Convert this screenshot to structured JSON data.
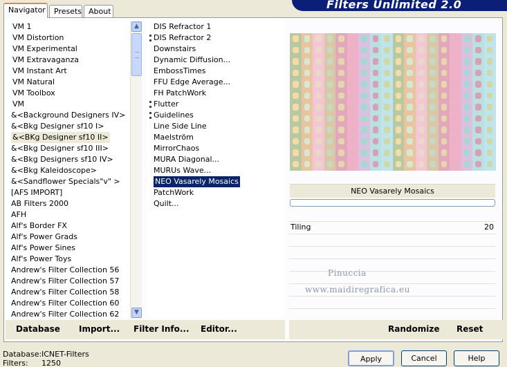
{
  "tabs": {
    "navigator": "Navigator",
    "presets": "Presets",
    "about": "About"
  },
  "brand": "Filters Unlimited 2.0",
  "categories": [
    "VM 1",
    "VM Distortion",
    "VM Experimental",
    "VM Extravaganza",
    "VM Instant Art",
    "VM Natural",
    "VM Toolbox",
    "VM",
    "&<Background Designers IV>",
    "&<Bkg Designer sf10 I>",
    "&<BKg Designer sf10 II>",
    "&<Bkg Designer sf10 III>",
    "&<Bkg Designers sf10 IV>",
    "&<Bkg Kaleidoscope>",
    "&<Sandflower Specials\"v\" >",
    "[AFS IMPORT]",
    "AB Filters 2000",
    "AFH",
    "Alf's Border FX",
    "Alf's Power Grads",
    "Alf's Power Sines",
    "Alf's Power Toys",
    "Andrew's Filter Collection 56",
    "Andrew's Filter Collection 57",
    "Andrew's Filter Collection 58",
    "Andrew's Filter Collection 60",
    "Andrew's Filter Collection 62"
  ],
  "filters": [
    "DIS Refractor 1",
    "DIS Refractor 2",
    "Downstairs",
    "Dynamic Diffusion...",
    "EmbossTimes",
    "FFU Edge Average...",
    "FH PatchWork",
    "Flutter",
    "Guidelines",
    "Line Side Line",
    "Maelström",
    "MirrorChaos",
    "MURA Diagonal...",
    "MURUs Wave...",
    "NEO Vasarely Mosaics",
    "PatchWork",
    "Quilt..."
  ],
  "preview_filter_name": "NEO Vasarely Mosaics",
  "param": {
    "label": "Tiling",
    "value": "20"
  },
  "watermark": {
    "line1": "Pinuccia",
    "line2": "www.maidiregrafica.eu"
  },
  "bottom_left": {
    "database": "Database",
    "import": "Import...",
    "filter_info": "Filter Info...",
    "editor": "Editor..."
  },
  "bottom_right": {
    "randomize": "Randomize",
    "reset": "Reset"
  },
  "status": {
    "db_label": "Database:",
    "db_value": "ICNET-Filters",
    "filters_label": "Filters:",
    "filters_value": "1250"
  },
  "buttons": {
    "apply": "Apply",
    "cancel": "Cancel",
    "help": "Help"
  },
  "colors": {
    "selection": "#0a246a",
    "brand_bg": "#0b1e78",
    "panel": "#ece9d8"
  }
}
